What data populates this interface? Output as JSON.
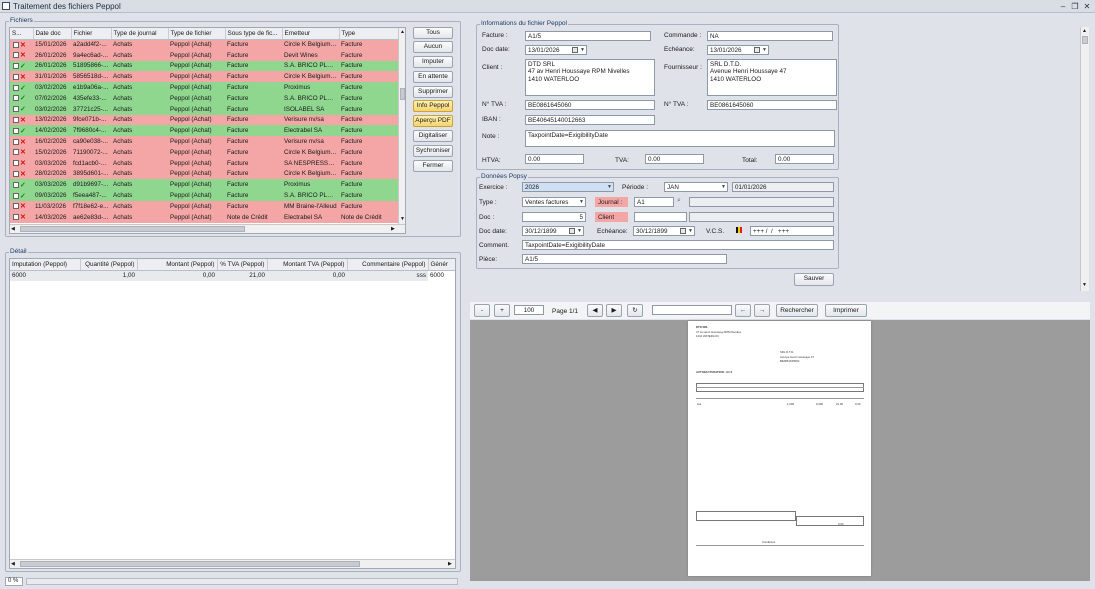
{
  "window": {
    "title": "Traitement des fichiers Peppol"
  },
  "fichiers": {
    "group_label": "Fichiers",
    "columns": [
      "S...",
      "Date doc",
      "Fichier",
      "Type de journal",
      "Type de fichier",
      "Sous type de fic...",
      "Emetteur",
      "Type"
    ],
    "rows": [
      {
        "status": "x",
        "color": "red",
        "date": "15/01/2026",
        "fichier": "a2add4f2-...",
        "journal": "Achats",
        "type_fichier": "Peppol (Achat)",
        "sous_type": "Facture",
        "emetteur": "Circle K Belgium N...",
        "type": "Facture"
      },
      {
        "status": "x",
        "color": "red",
        "date": "26/01/2026",
        "fichier": "9a4ec6ad-...",
        "journal": "Achats",
        "type_fichier": "Peppol (Achat)",
        "sous_type": "Facture",
        "emetteur": "Devit Wines",
        "type": "Facture"
      },
      {
        "status": "v",
        "color": "green",
        "date": "26/01/2026",
        "fichier": "51895866-...",
        "journal": "Achats",
        "type_fichier": "Peppol (Achat)",
        "sous_type": "Facture",
        "emetteur": "S.A. BRICO PLAN...",
        "type": "Facture"
      },
      {
        "status": "x",
        "color": "red",
        "date": "31/01/2026",
        "fichier": "5856518d-...",
        "journal": "Achats",
        "type_fichier": "Peppol (Achat)",
        "sous_type": "Facture",
        "emetteur": "Circle K Belgium N...",
        "type": "Facture"
      },
      {
        "status": "v",
        "color": "green",
        "date": "03/02/2026",
        "fichier": "e1b9a06a-...",
        "journal": "Achats",
        "type_fichier": "Peppol (Achat)",
        "sous_type": "Facture",
        "emetteur": "Proximus",
        "type": "Facture"
      },
      {
        "status": "v",
        "color": "green",
        "date": "07/02/2026",
        "fichier": "435efe33-...",
        "journal": "Achats",
        "type_fichier": "Peppol (Achat)",
        "sous_type": "Facture",
        "emetteur": "S.A. BRICO PLAN...",
        "type": "Facture"
      },
      {
        "status": "v",
        "color": "green",
        "date": "03/02/2026",
        "fichier": "37721c25-...",
        "journal": "Achats",
        "type_fichier": "Peppol (Achat)",
        "sous_type": "Facture",
        "emetteur": "ISOLABEL SA",
        "type": "Facture"
      },
      {
        "status": "x",
        "color": "red",
        "date": "13/02/2026",
        "fichier": "9fce071b-...",
        "journal": "Achats",
        "type_fichier": "Peppol (Achat)",
        "sous_type": "Facture",
        "emetteur": "Verisure nv/sa",
        "type": "Facture"
      },
      {
        "status": "v",
        "color": "green",
        "date": "14/02/2026",
        "fichier": "7f9680c4-...",
        "journal": "Achats",
        "type_fichier": "Peppol (Achat)",
        "sous_type": "Facture",
        "emetteur": "Electrabel SA",
        "type": "Facture"
      },
      {
        "status": "x",
        "color": "red",
        "date": "16/02/2026",
        "fichier": "ca90e038-...",
        "journal": "Achats",
        "type_fichier": "Peppol (Achat)",
        "sous_type": "Facture",
        "emetteur": "Verisure nv/sa",
        "type": "Facture"
      },
      {
        "status": "x",
        "color": "red",
        "date": "15/02/2026",
        "fichier": "71190072-...",
        "journal": "Achats",
        "type_fichier": "Peppol (Achat)",
        "sous_type": "Facture",
        "emetteur": "Circle K Belgium N...",
        "type": "Facture"
      },
      {
        "status": "x",
        "color": "red",
        "date": "03/03/2026",
        "fichier": "fcd1acb0-8...",
        "journal": "Achats",
        "type_fichier": "Peppol (Achat)",
        "sous_type": "Facture",
        "emetteur": "SA NESPRESSO B...",
        "type": "Facture"
      },
      {
        "status": "x",
        "color": "red",
        "date": "28/02/2026",
        "fichier": "3895d601-...",
        "journal": "Achats",
        "type_fichier": "Peppol (Achat)",
        "sous_type": "Facture",
        "emetteur": "Circle K Belgium N...",
        "type": "Facture"
      },
      {
        "status": "v",
        "color": "green",
        "date": "03/03/2026",
        "fichier": "d91b9697-...",
        "journal": "Achats",
        "type_fichier": "Peppol (Achat)",
        "sous_type": "Facture",
        "emetteur": "Proximus",
        "type": "Facture"
      },
      {
        "status": "v",
        "color": "green",
        "date": "09/03/2026",
        "fichier": "f5eea487-...",
        "journal": "Achats",
        "type_fichier": "Peppol (Achat)",
        "sous_type": "Facture",
        "emetteur": "S.A. BRICO PLAN...",
        "type": "Facture"
      },
      {
        "status": "x",
        "color": "red",
        "date": "11/03/2026",
        "fichier": "f7f18e62-e...",
        "journal": "Achats",
        "type_fichier": "Peppol (Achat)",
        "sous_type": "Facture",
        "emetteur": "MM Braine-l'Alleud",
        "type": "Facture"
      },
      {
        "status": "x",
        "color": "red",
        "date": "14/03/2026",
        "fichier": "ae62e83d-...",
        "journal": "Achats",
        "type_fichier": "Peppol (Achat)",
        "sous_type": "Note de Crédit",
        "emetteur": "Electrabel SA",
        "type": "Note de Crédit"
      }
    ],
    "buttons": [
      "Tous",
      "Aucun",
      "Imputer",
      "En attente",
      "Supprimer",
      "Info Peppol",
      "Aperçu PDF",
      "Digitaliser",
      "Sychroniser",
      "Fermer"
    ]
  },
  "detail": {
    "group_label": "Détail",
    "columns": [
      "Imputation (Peppol)",
      "Quantité (Peppol)",
      "Montant (Peppol)",
      "% TVA (Peppol)",
      "Montant TVA (Peppol)",
      "Commentaire (Peppol)",
      "Génér"
    ],
    "rows": [
      {
        "imputation": "6000",
        "quantite": "1,00",
        "montant": "0,00",
        "tva_pct": "21,00",
        "montant_tva": "0,00",
        "commentaire": "sss",
        "gener": "6000"
      }
    ]
  },
  "progress": {
    "label": "0 %",
    "value": 0
  },
  "info_peppol": {
    "group_label": "Informations du fichier Peppol",
    "facture_label": "Facture :",
    "facture": "A1/5",
    "commande_label": "Commande :",
    "commande": "NA",
    "docdate_label": "Doc date:",
    "docdate": "13/01/2026",
    "echeance_label": "Echéance:",
    "echeance": "13/01/2026",
    "client_label": "Client :",
    "client": "DTD SRL\n47 av Henri Houssaye RPM Nivelles\n1410 WATERLOO",
    "fournisseur_label": "Fournisseur :",
    "fournisseur": "SRL D.T.D.\nAvenue Henri Houssaye 47\n1410 WATERLOO",
    "tva_label": "N° TVA :",
    "tva_client": "BE0861645060",
    "tva_fournisseur": "BE0861645060",
    "iban_label": "IBAN :",
    "iban": "BE40645140012663",
    "note_label": "Note :",
    "note": "TaxpointDate=ExigibilityDate",
    "htva_label": "HTVA:",
    "htva": "0.00",
    "tvaamt_label": "TVA:",
    "tvaamt": "0.00",
    "total_label": "Total:",
    "total": "0.00"
  },
  "popsy": {
    "group_label": "Données Popsy",
    "exercice_label": "Exercice :",
    "exercice": "2026",
    "periode_label": "Période :",
    "periode": "JAN",
    "periode_date": "01/01/2026",
    "type_label": "Type :",
    "type": "Ventes factures",
    "journal_label": "Journal :",
    "journal": "A1",
    "doc_label": "Doc :",
    "doc": "5",
    "client_label": "Client",
    "docdate_label": "Doc date:",
    "docdate": "30/12/1899",
    "echeance_label": "Echéance:",
    "echeance": "30/12/1899",
    "vcs_label": "V.C.S.",
    "vcs": "+++ /  /   +++",
    "comment_label": "Comment.",
    "comment": "TaxpointDate=ExigibilityDate",
    "piece_label": "Pièce:",
    "piece": "A1/5",
    "save_label": "Sauver"
  },
  "pdf_toolbar": {
    "minus": "-",
    "plus": "+",
    "zoom": "100",
    "page_label": "Page 1/1",
    "search_value": "",
    "prev_arrow": "←",
    "next_arrow": "→",
    "search_label": "Rechercher",
    "print_label": "Imprimer"
  },
  "pdf_page": {
    "company": "DTD SRL",
    "company_addr1": "47 av Henri Houssaye RPM Nivelles",
    "company_addr2": "1410 WATERLOO",
    "recipient1": "SRL D.T.D.",
    "recipient2": "Avenue Henri Houssaye 47",
    "recipient3": "BE0861645060",
    "heading": "AUTOFACTURATION : A1-5",
    "line_item": "sss",
    "qty": "1,000",
    "amount": "0,000",
    "pct": "21,00",
    "total": "0,00",
    "grand_total": "0,00",
    "footer_label": "Conditions"
  },
  "colors": {
    "red_row": "#f4a5a5",
    "green_row": "#8fd68f",
    "accent_button": "#f6d36c"
  }
}
